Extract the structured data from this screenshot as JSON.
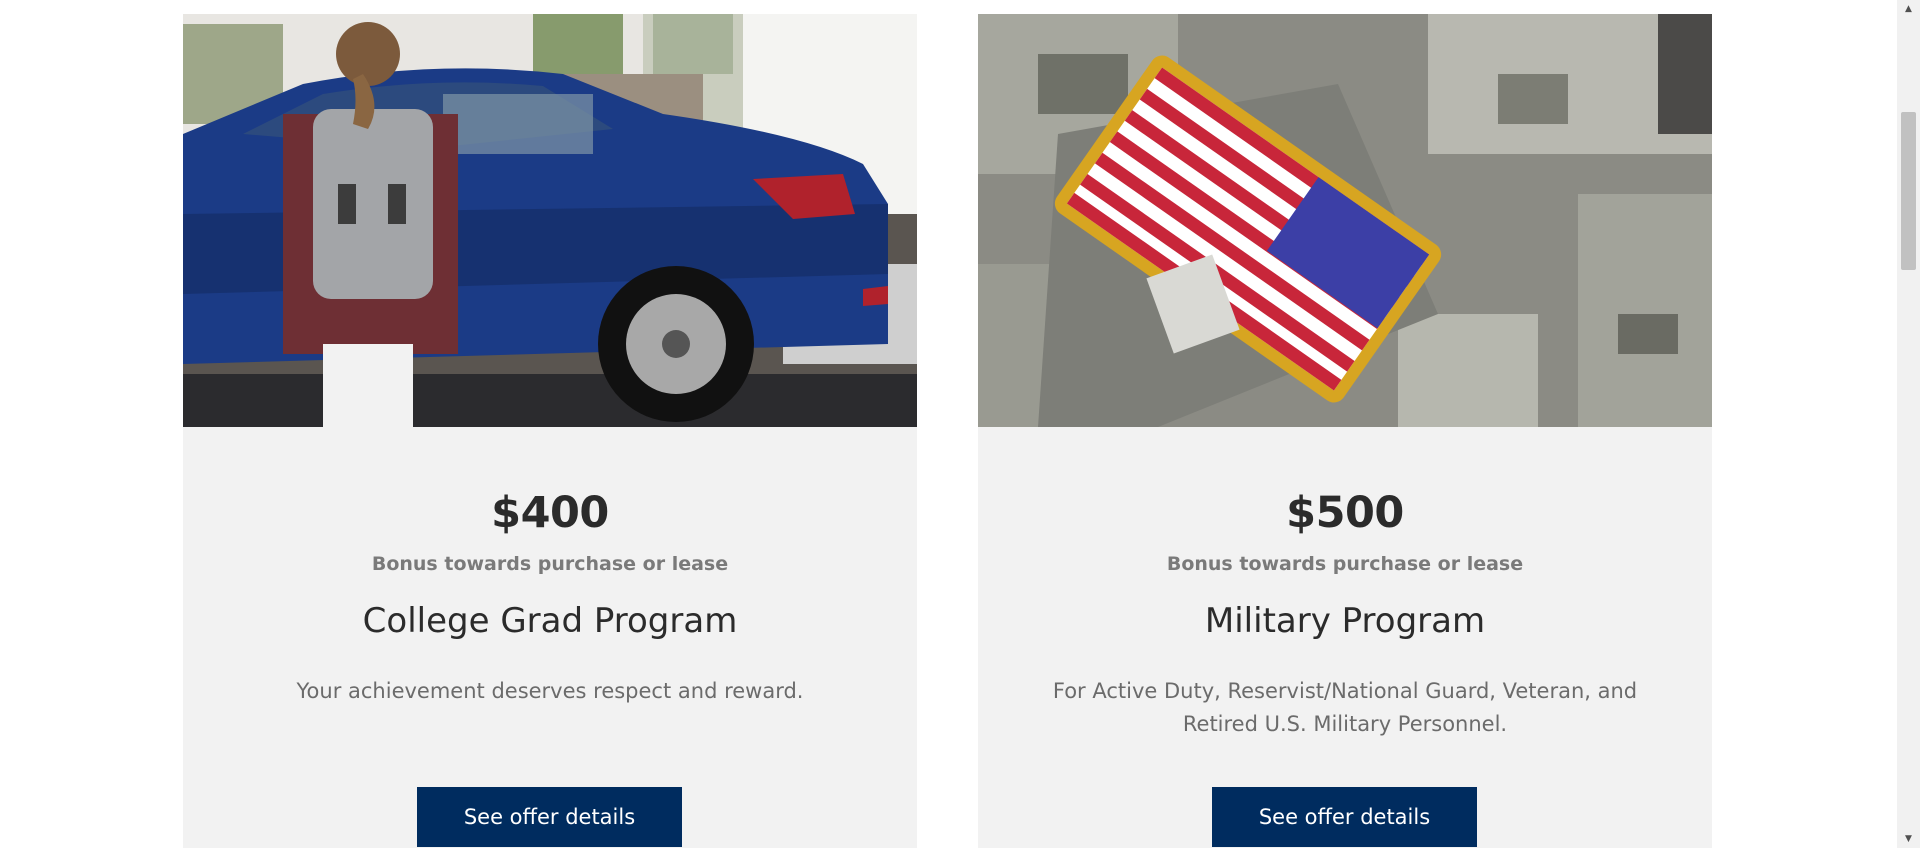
{
  "offers": [
    {
      "image_alt": "Student with backpack standing next to a blue sedan",
      "amount": "$400",
      "bonus_text": "Bonus towards purchase or lease",
      "program_title": "College Grad Program",
      "description": "Your achievement deserves respect and reward.",
      "button_label": "See offer details"
    },
    {
      "image_alt": "American flag patch on a camouflage military uniform sleeve",
      "amount": "$500",
      "bonus_text": "Bonus towards purchase or lease",
      "program_title": "Military Program",
      "description": "For Active Duty, Reservist/National Guard, Veteran, and Retired U.S. Military Personnel.",
      "button_label": "See offer details"
    }
  ],
  "colors": {
    "button_bg": "#002c5f",
    "card_bg": "#f2f2f2",
    "heading_text": "#2b2b2b",
    "muted_text": "#7a7a7a"
  },
  "scrollbar": {
    "up_icon": "triangle-up-icon",
    "down_icon": "triangle-down-icon"
  }
}
